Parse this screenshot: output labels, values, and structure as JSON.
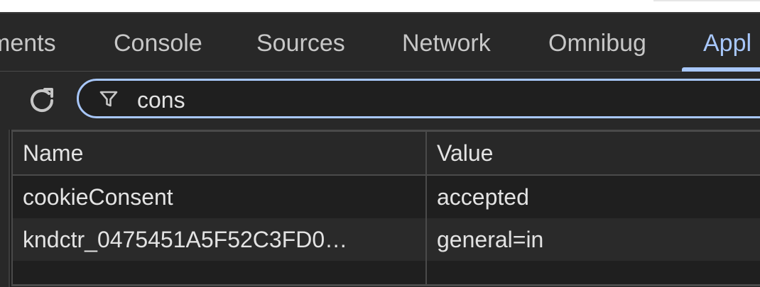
{
  "tabs": [
    {
      "label": "ments",
      "active": false
    },
    {
      "label": "Console",
      "active": false
    },
    {
      "label": "Sources",
      "active": false
    },
    {
      "label": "Network",
      "active": false
    },
    {
      "label": "Omnibug",
      "active": false
    },
    {
      "label": "Appl",
      "active": true
    }
  ],
  "toolbar": {
    "refresh_icon": "refresh-icon",
    "filter_icon": "filter-icon",
    "filter_value": "cons"
  },
  "table": {
    "columns": [
      "Name",
      "Value"
    ],
    "rows": [
      {
        "name": "cookieConsent",
        "value": "accepted"
      },
      {
        "name": "kndctr_0475451A5F52C3FD0…",
        "value": "general=in"
      }
    ]
  },
  "colors": {
    "accent": "#a8c7fa",
    "panel_bg": "#1f1f1f",
    "toolbar_bg": "#282828",
    "text": "#e3e3e3",
    "tab_text": "#c7c7c7"
  }
}
